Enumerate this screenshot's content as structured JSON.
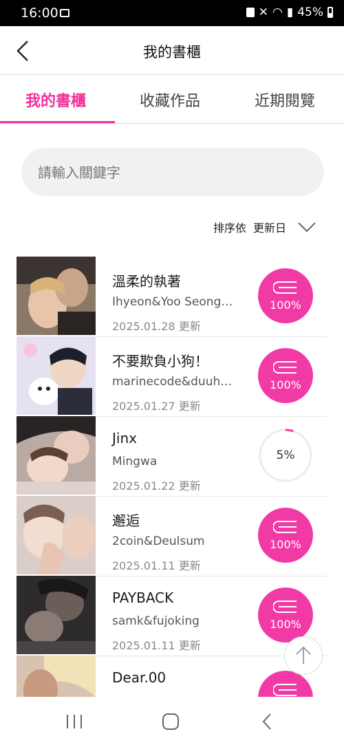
{
  "status": {
    "time": "16:00",
    "battery": "45%"
  },
  "header": {
    "title": "我的書櫃"
  },
  "tabs": [
    {
      "label": "我的書櫃",
      "active": true
    },
    {
      "label": "收藏作品",
      "active": false
    },
    {
      "label": "近期閱覽",
      "active": false
    }
  ],
  "search": {
    "placeholder": "請輸入關鍵字",
    "value": ""
  },
  "sort": {
    "label": "排序依",
    "value": "更新日"
  },
  "colors": {
    "accent": "#f0309a",
    "badge": "#f23aa6"
  },
  "items": [
    {
      "title": "溫柔的執著",
      "author": "Ihyeon&Yoo Seong…",
      "date": "2025.01.28 更新",
      "progress": "100%",
      "progress_value": 100
    },
    {
      "title": "不要欺負小狗！",
      "author": "marinecode&duuh…",
      "date": "2025.01.27 更新",
      "progress": "100%",
      "progress_value": 100
    },
    {
      "title": "Jinx",
      "author": "Mingwa",
      "date": "2025.01.22 更新",
      "progress": "5%",
      "progress_value": 5
    },
    {
      "title": "邂逅",
      "author": "2coin&Deulsum",
      "date": "2025.01.11 更新",
      "progress": "100%",
      "progress_value": 100
    },
    {
      "title": "PAYBACK",
      "author": "samk&fujoking",
      "date": "2025.01.11 更新",
      "progress": "100%",
      "progress_value": 100
    },
    {
      "title": "Dear.00",
      "author": "",
      "date": "",
      "progress": "",
      "progress_value": 100
    }
  ]
}
